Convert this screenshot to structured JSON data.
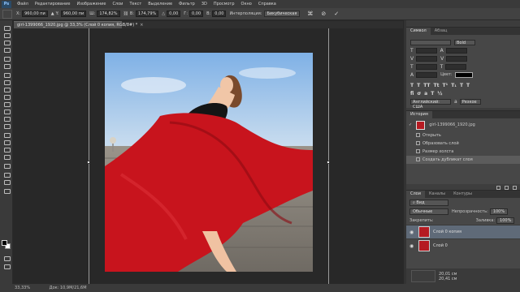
{
  "app": {
    "logo": "Ps"
  },
  "menu": [
    "Файл",
    "Редактирование",
    "Изображение",
    "Слои",
    "Текст",
    "Выделение",
    "Фильтр",
    "3D",
    "Просмотр",
    "Окно",
    "Справка"
  ],
  "options_bar": {
    "x_label": "X:",
    "x_value": "960,00 пи",
    "y_label": "Y:",
    "y_value": "960,00 пи",
    "w_label": "Ш:",
    "w_value": "174,82%",
    "h_label": "В:",
    "h_value": "174,79%",
    "angle_value": "0,00",
    "hskew_label": "Г:",
    "hskew_value": "0,00",
    "vskew_label": "В:",
    "vskew_value": "0,00",
    "interp_label": "Интерполяция:",
    "interp_value": "Бикубическая"
  },
  "document": {
    "tab_title": "girl-1399066_1920.jpg @ 33,3% (Слой 0 копия, RGB/8#) *",
    "close": "×"
  },
  "status": {
    "zoom": "33,33%",
    "doc": "Док: 10,9M/21,6M"
  },
  "character_panel": {
    "tabs": [
      "Символ",
      "Абзац"
    ],
    "font_style": "Bold",
    "color_label": "Цвет:",
    "lang_label": "Английский: США",
    "aa_value": "Резкое"
  },
  "history_panel": {
    "tabs": [
      "История"
    ],
    "snapshot_label": "girl-1399066_1920.jpg",
    "items": [
      "Открыть",
      "Образовать слой",
      "Размер холста",
      "Создать дубликат слоя"
    ]
  },
  "layers_panel": {
    "tabs": [
      "Слои",
      "Каналы",
      "Контуры"
    ],
    "kind_label": "Вид",
    "blend_mode": "Обычные",
    "opacity_label": "Непрозрачность:",
    "opacity_value": "100%",
    "lock_label": "Закрепить:",
    "fill_label": "Заливка:",
    "fill_value": "100%",
    "layers": [
      {
        "name": "Слой 0 копия",
        "visible": true
      },
      {
        "name": "Слой 0",
        "visible": true
      }
    ]
  },
  "navigator": {
    "size1": "20,01 см",
    "size2": "20,41 см"
  },
  "colors": {
    "skirt_red": "#c8141d",
    "sky_blue": "#9cc5ee",
    "selection": "#5f6a78"
  }
}
